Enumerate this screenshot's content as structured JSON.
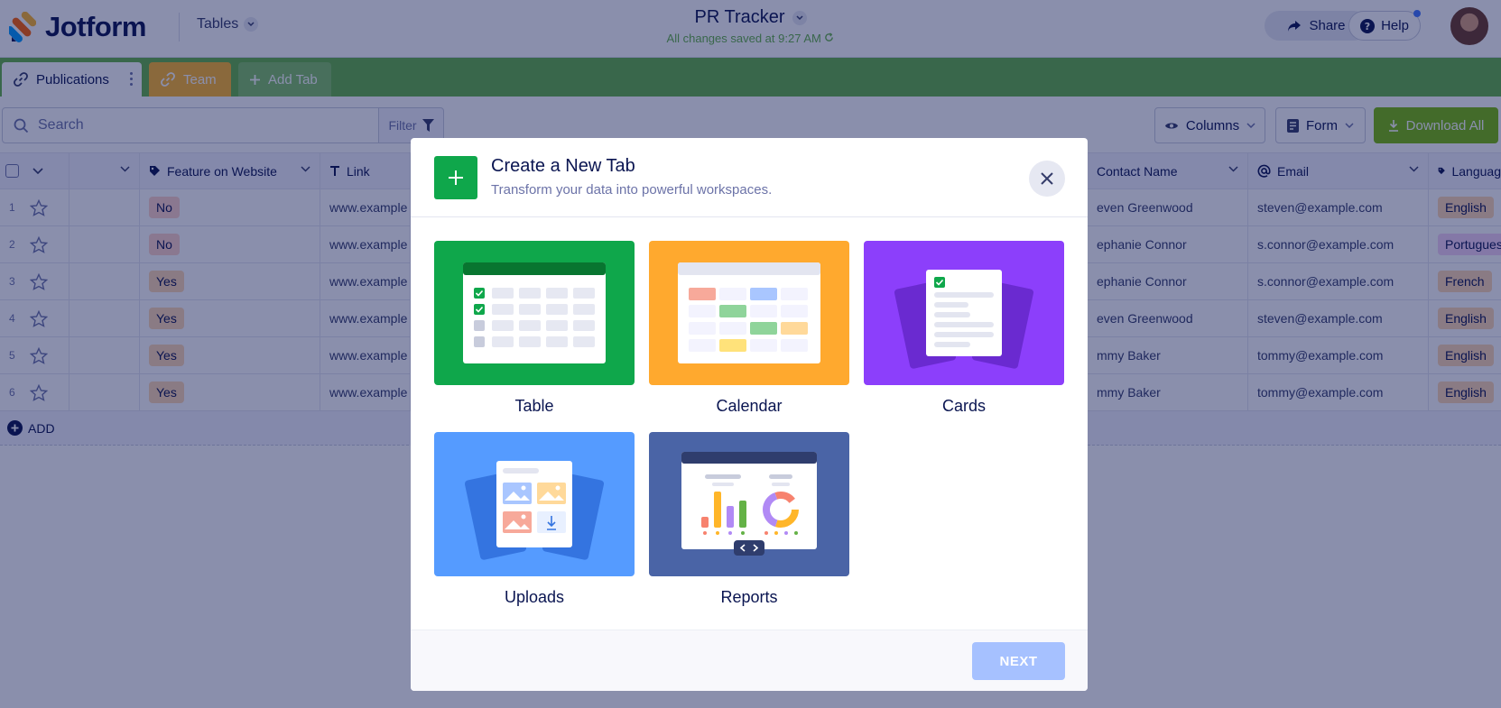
{
  "header": {
    "brand": "Jotform",
    "tables_menu": "Tables",
    "title": "PR Tracker",
    "saved_status": "All changes saved at 9:27 AM",
    "share_label": "Share",
    "help_label": "Help"
  },
  "tabs": [
    {
      "label": "Publications"
    },
    {
      "label": "Team"
    },
    {
      "label": "Add Tab"
    }
  ],
  "toolbar": {
    "search_placeholder": "Search",
    "filter_label": "Filter",
    "columns_label": "Columns",
    "form_label": "Form",
    "download_label": "Download All"
  },
  "grid": {
    "columns": [
      "Feature on Website",
      "Link",
      "Contact Name",
      "Email",
      "Languag"
    ],
    "rows": [
      {
        "num": "1",
        "feature": "No",
        "link": "www.example",
        "contact": "even Greenwood",
        "email": "steven@example.com",
        "language": "English"
      },
      {
        "num": "2",
        "feature": "No",
        "link": "www.example",
        "contact": "ephanie Connor",
        "email": "s.connor@example.com",
        "language": "Portugues"
      },
      {
        "num": "3",
        "feature": "Yes",
        "link": "www.example",
        "contact": "ephanie Connor",
        "email": "s.connor@example.com",
        "language": "French"
      },
      {
        "num": "4",
        "feature": "Yes",
        "link": "www.example",
        "contact": "even Greenwood",
        "email": "steven@example.com",
        "language": "English"
      },
      {
        "num": "5",
        "feature": "Yes",
        "link": "www.example",
        "contact": "mmy Baker",
        "email": "tommy@example.com",
        "language": "English"
      },
      {
        "num": "6",
        "feature": "Yes",
        "link": "www.example",
        "contact": "mmy Baker",
        "email": "tommy@example.com",
        "language": "English"
      }
    ],
    "add_label": "ADD"
  },
  "modal": {
    "title": "Create a New Tab",
    "subtitle": "Transform your data into powerful workspaces.",
    "options": [
      {
        "label": "Table",
        "color": "#0fa74b"
      },
      {
        "label": "Calendar",
        "color": "#ffa92e"
      },
      {
        "label": "Cards",
        "color": "#8c3ffb"
      },
      {
        "label": "Uploads",
        "color": "#559bff"
      },
      {
        "label": "Reports",
        "color": "#4a64a6"
      }
    ],
    "next_label": "NEXT"
  },
  "colors": {
    "accent_green": "#64b246",
    "navy": "#0a1551",
    "team_tab": "#ffb629",
    "download_green": "#78bb07",
    "next_disabled": "#a6c1ff"
  }
}
